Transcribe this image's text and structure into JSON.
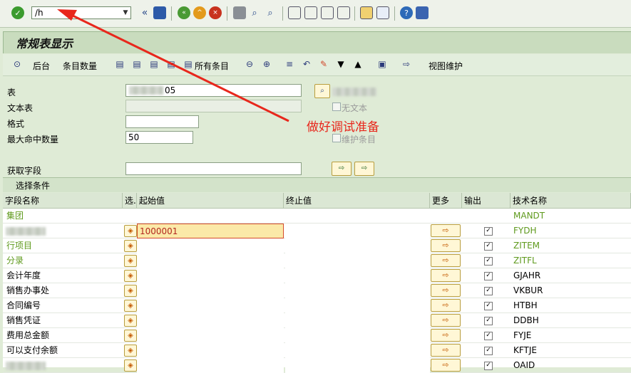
{
  "toolbar": {
    "command_value": "/h",
    "icons": [
      "enter-icon",
      "back-icon",
      "save-icon",
      "back-green-icon",
      "exit-icon",
      "cancel-icon",
      "print-icon",
      "find-icon",
      "find-next-icon",
      "first-page-icon",
      "prev-page-icon",
      "next-page-icon",
      "last-page-icon",
      "create-session-icon",
      "shortcut-icon",
      "help-icon",
      "layout-icon"
    ]
  },
  "title": "常规表显示",
  "app_toolbar": {
    "background_label": "后台",
    "entry_count_label": "条目数量",
    "all_entries_label": "所有条目",
    "view_maint_label": "视图维护"
  },
  "form": {
    "table_label": "表",
    "table_value": "05",
    "text_table_label": "文本表",
    "no_text_label": "无文本",
    "format_label": "格式",
    "max_hits_label": "最大命中数量",
    "max_hits_value": "50",
    "maintain_entries_label": "维护条目",
    "get_fields_label": "获取字段"
  },
  "annotation": {
    "text": "做好调试准备",
    "color": "#e8271c"
  },
  "selection": {
    "header": "选择条件",
    "columns": {
      "field_name": "字段名称",
      "sel": "选.",
      "from": "起始值",
      "to": "终止值",
      "more": "更多",
      "output": "输出",
      "tech_name": "技术名称"
    },
    "rows": [
      {
        "name": "集团",
        "from": "",
        "tech": "MANDT",
        "green": true,
        "has_controls": false
      },
      {
        "name": "",
        "from": "1000001",
        "tech": "FYDH",
        "green": true,
        "has_controls": true,
        "output": "✓"
      },
      {
        "name": "行项目",
        "from": "",
        "tech": "ZITEM",
        "green": true,
        "has_controls": true,
        "output": "✓"
      },
      {
        "name": "分录",
        "from": "",
        "tech": "ZITFL",
        "green": true,
        "has_controls": true,
        "output": "✓"
      },
      {
        "name": "会计年度",
        "from": "",
        "tech": "GJAHR",
        "green": false,
        "has_controls": true,
        "output": "✓"
      },
      {
        "name": "销售办事处",
        "from": "",
        "tech": "VKBUR",
        "green": false,
        "has_controls": true,
        "output": "✓"
      },
      {
        "name": "合同编号",
        "from": "",
        "tech": "HTBH",
        "green": false,
        "has_controls": true,
        "output": "✓"
      },
      {
        "name": "销售凭证",
        "from": "",
        "tech": "DDBH",
        "green": false,
        "has_controls": true,
        "output": "✓"
      },
      {
        "name": "费用总金额",
        "from": "",
        "tech": "FYJE",
        "green": false,
        "has_controls": true,
        "output": "✓"
      },
      {
        "name": "可以支付余额",
        "from": "",
        "tech": "KFTJE",
        "green": false,
        "has_controls": true,
        "output": "✓"
      },
      {
        "name": "",
        "from": "",
        "tech": "OAID",
        "green": false,
        "has_controls": true,
        "output": "✓"
      }
    ]
  }
}
